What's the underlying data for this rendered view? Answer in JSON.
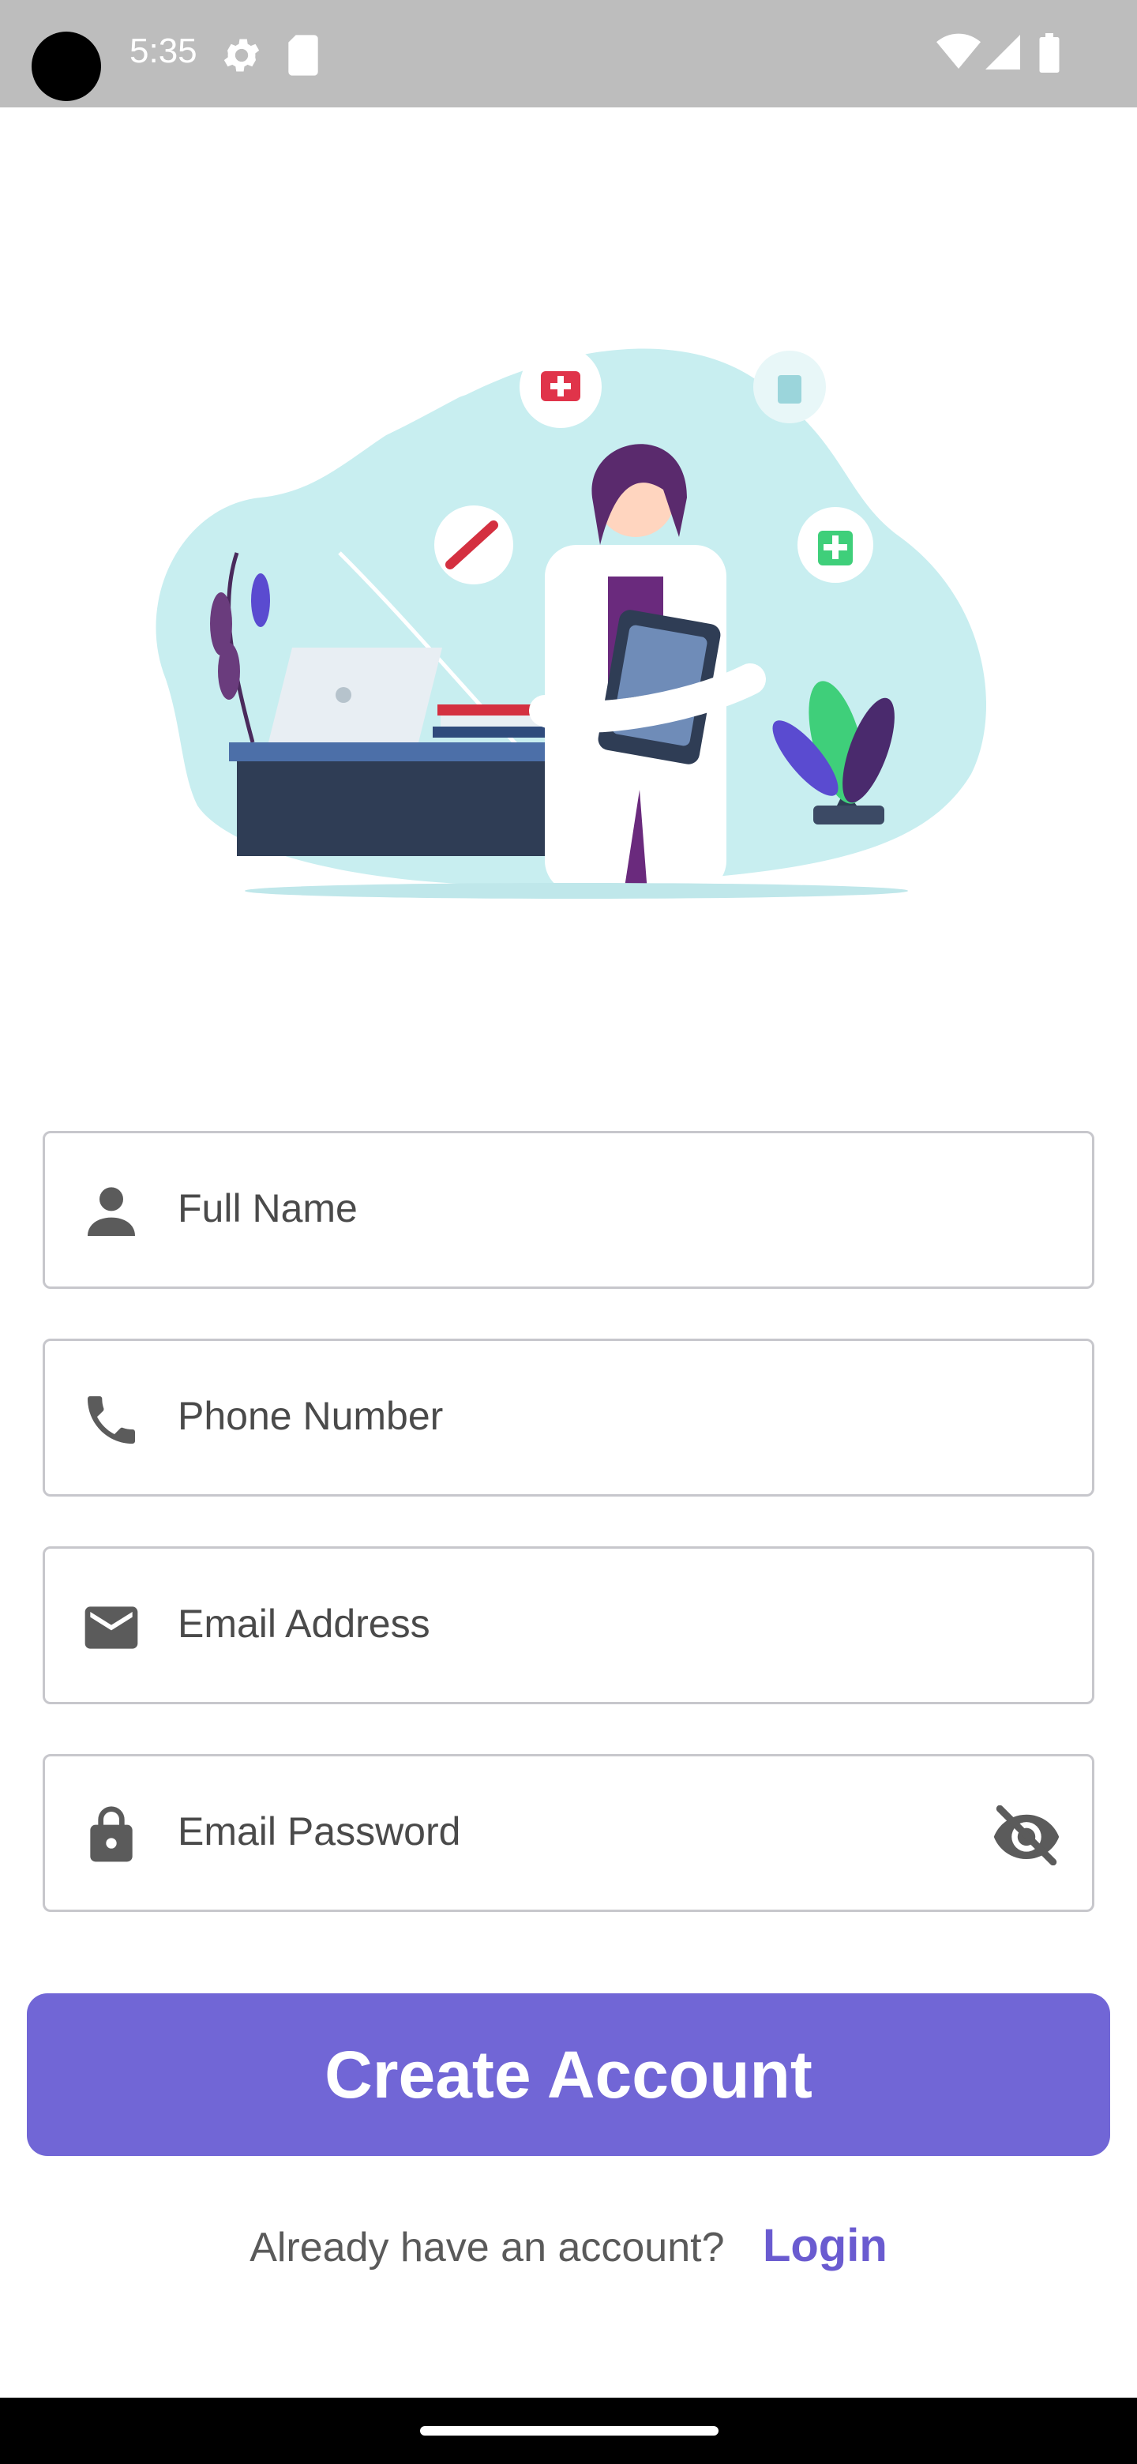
{
  "status_bar": {
    "time": "5:35",
    "icons": [
      "settings-icon",
      "sd-card-icon",
      "wifi-icon",
      "signal-icon",
      "battery-icon"
    ]
  },
  "illustration": {
    "subject": "doctor-illustration"
  },
  "form": {
    "full_name": {
      "placeholder": "Full Name",
      "icon": "person-icon"
    },
    "phone": {
      "placeholder": "Phone Number",
      "icon": "phone-icon"
    },
    "email": {
      "placeholder": "Email Address",
      "icon": "mail-icon"
    },
    "password": {
      "placeholder": "Email Password",
      "icon": "lock-icon",
      "toggle_icon": "eye-off-icon"
    }
  },
  "actions": {
    "create_account_label": "Create Account",
    "login_prompt": "Already have an account?",
    "login_link": "Login"
  },
  "colors": {
    "accent": "#7166d6",
    "link": "#6a5bd0",
    "status_bar": "#bdbdbd"
  }
}
